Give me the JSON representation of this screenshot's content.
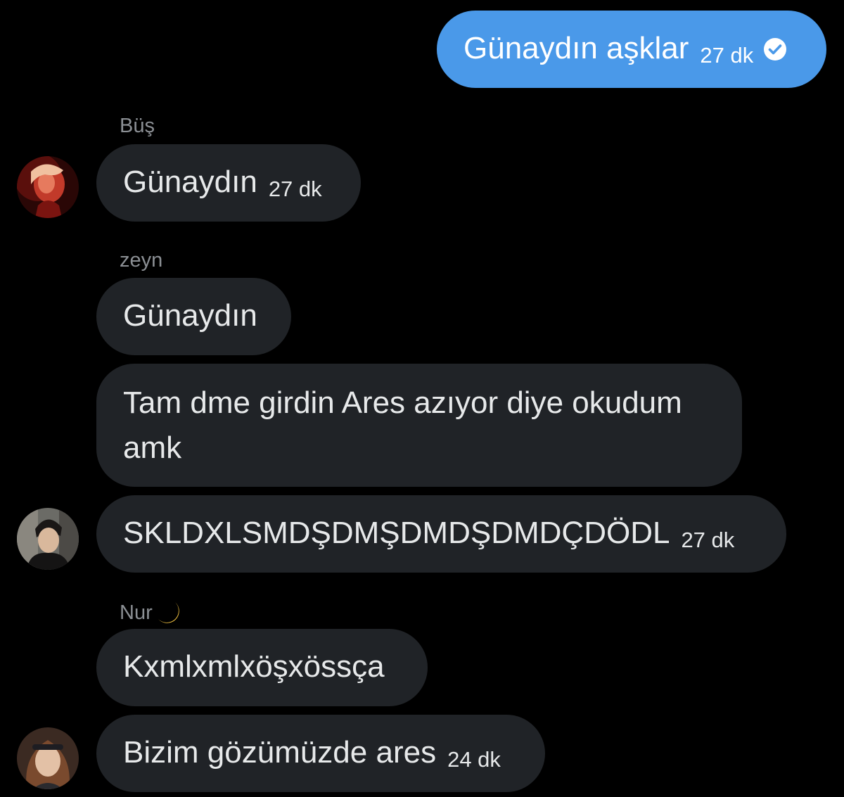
{
  "messages": {
    "m1": {
      "text": "Günaydın aşklar",
      "time": "27 dk"
    },
    "m2": {
      "sender": "Büş",
      "text": "Günaydın",
      "time": "27 dk"
    },
    "m3": {
      "sender": "zeyn",
      "text": "Günaydın"
    },
    "m4": {
      "text": "Tam dme girdin Ares azıyor diye okudum amk"
    },
    "m5": {
      "text": "SKLDXLSMDŞDMŞDMDŞDMDÇDÖDL",
      "time": "27 dk"
    },
    "m6": {
      "sender": "Nur",
      "text": "Kxmlxmlxöşxössça"
    },
    "m7": {
      "text": "Bizim gözümüzde ares",
      "time": "24 dk"
    }
  },
  "colors": {
    "background": "#000000",
    "sent_bubble": "#4a99e9",
    "received_bubble": "#202327",
    "sender_name": "#8b8f94"
  },
  "icons": {
    "read_receipt": "check-circle-icon",
    "moon": "crescent-moon-icon"
  }
}
